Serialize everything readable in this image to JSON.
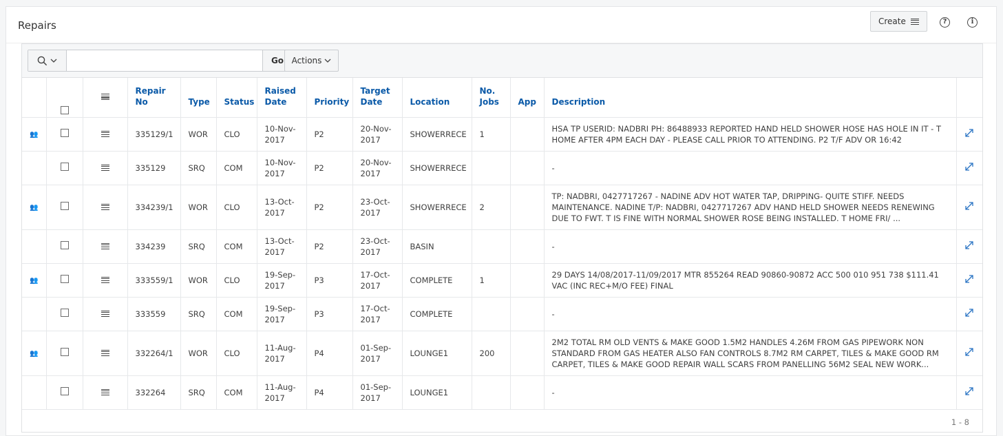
{
  "region": {
    "title": "Repairs",
    "create_label": "Create",
    "help_icon_char": "?",
    "info_icon_char": "i"
  },
  "toolbar": {
    "search_value": "",
    "go_label": "Go",
    "actions_label": "Actions"
  },
  "columns": [
    "Repair No",
    "Type",
    "Status",
    "Raised Date",
    "Priority",
    "Target Date",
    "Location",
    "No. Jobs",
    "App",
    "Description"
  ],
  "rows": [
    {
      "person": true,
      "repair_no": "335129/1",
      "type": "WOR",
      "status": "CLO",
      "raised": "10-Nov-2017",
      "priority": "P2",
      "target": "20-Nov-2017",
      "location": "SHOWERRECE",
      "jobs": "1",
      "app": "",
      "description": "HSA TP USERID: NADBRI PH: 86488933 REPORTED HAND HELD SHOWER HOSE HAS HOLE IN IT - T HOME AFTER 4PM EACH DAY - PLEASE CALL PRIOR TO ATTENDING. P2 T/F ADV OR 16:42"
    },
    {
      "person": false,
      "repair_no": "335129",
      "type": "SRQ",
      "status": "COM",
      "raised": "10-Nov-2017",
      "priority": "P2",
      "target": "20-Nov-2017",
      "location": "SHOWERRECE",
      "jobs": "",
      "app": "",
      "description": "-"
    },
    {
      "person": true,
      "repair_no": "334239/1",
      "type": "WOR",
      "status": "CLO",
      "raised": "13-Oct-2017",
      "priority": "P2",
      "target": "23-Oct-2017",
      "location": "SHOWERRECE",
      "jobs": "2",
      "app": "",
      "description": "TP: NADBRI, 0427717267 - NADINE ADV HOT WATER TAP, DRIPPING- QUITE STIFF. NEEDS MAINTENANCE. NADINE T/P: NADBRI, 0427717267 ADV HAND HELD SHOWER NEEDS RENEWING DUE TO FWT. T IS FINE WITH NORMAL SHOWER ROSE BEING INSTALLED. T HOME FRI/ ..."
    },
    {
      "person": false,
      "repair_no": "334239",
      "type": "SRQ",
      "status": "COM",
      "raised": "13-Oct-2017",
      "priority": "P2",
      "target": "23-Oct-2017",
      "location": "BASIN",
      "jobs": "",
      "app": "",
      "description": "-"
    },
    {
      "person": true,
      "repair_no": "333559/1",
      "type": "WOR",
      "status": "CLO",
      "raised": "19-Sep-2017",
      "priority": "P3",
      "target": "17-Oct-2017",
      "location": "COMPLETE",
      "jobs": "1",
      "app": "",
      "description": "29 DAYS 14/08/2017-11/09/2017 MTR 855264 READ 90860-90872 ACC 500 010 951 738 $111.41 VAC (INC REC+M/O FEE) FINAL"
    },
    {
      "person": false,
      "repair_no": "333559",
      "type": "SRQ",
      "status": "COM",
      "raised": "19-Sep-2017",
      "priority": "P3",
      "target": "17-Oct-2017",
      "location": "COMPLETE",
      "jobs": "",
      "app": "",
      "description": "-"
    },
    {
      "person": true,
      "repair_no": "332264/1",
      "type": "WOR",
      "status": "CLO",
      "raised": "11-Aug-2017",
      "priority": "P4",
      "target": "01-Sep-2017",
      "location": "LOUNGE1",
      "jobs": "200",
      "app": "",
      "description": "2M2 TOTAL RM OLD VENTS & MAKE GOOD 1.5M2 HANDLES 4.26M FROM GAS PIPEWORK NON STANDARD FROM GAS HEATER ALSO FAN CONTROLS 8.7M2 RM CARPET, TILES & MAKE GOOD RM CARPET, TILES & MAKE GOOD REPAIR WALL SCARS FROM PANELLING 56M2 SEAL NEW WORK..."
    },
    {
      "person": false,
      "repair_no": "332264",
      "type": "SRQ",
      "status": "COM",
      "raised": "11-Aug-2017",
      "priority": "P4",
      "target": "01-Sep-2017",
      "location": "LOUNGE1",
      "jobs": "",
      "app": "",
      "description": "-"
    }
  ],
  "pagination": "1 - 8"
}
